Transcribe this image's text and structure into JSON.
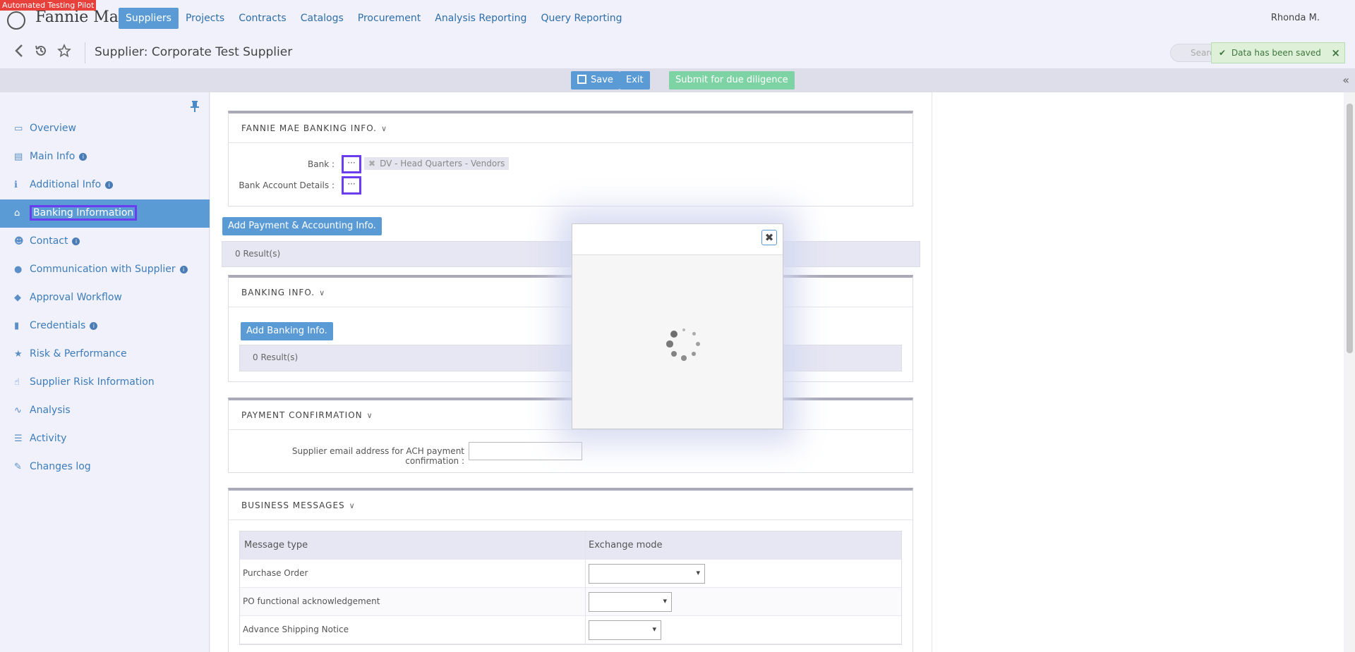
{
  "test_badge": "Automated Testing Pilot",
  "brand": {
    "name": "Fannie Mae",
    "tm": "™"
  },
  "nav": {
    "items": [
      {
        "label": "Suppliers",
        "active": true
      },
      {
        "label": "Projects"
      },
      {
        "label": "Contracts"
      },
      {
        "label": "Catalogs"
      },
      {
        "label": "Procurement"
      },
      {
        "label": "Analysis Reporting"
      },
      {
        "label": "Query Reporting"
      }
    ],
    "user": "Rhonda M."
  },
  "subheader": {
    "title": "Supplier: Corporate Test Supplier",
    "search_placeholder": "Search",
    "icons": [
      "back-icon",
      "history-icon",
      "star-icon"
    ]
  },
  "toast": {
    "message": "Data has been saved",
    "close": "×"
  },
  "actions": {
    "save": "Save",
    "exit": "Exit",
    "submit": "Submit for due diligence",
    "collapse": "«"
  },
  "sidebar": {
    "items": [
      {
        "label": "Overview",
        "icon": "monitor-icon"
      },
      {
        "label": "Main Info",
        "icon": "id-card-icon",
        "info": true
      },
      {
        "label": "Additional Info",
        "icon": "info-icon",
        "info": true
      },
      {
        "label": "Banking Information",
        "icon": "bank-icon",
        "active": true
      },
      {
        "label": "Contact",
        "icon": "users-icon",
        "info": true
      },
      {
        "label": "Communication with Supplier",
        "icon": "comments-icon",
        "info": true
      },
      {
        "label": "Approval Workflow",
        "icon": "binoculars-icon"
      },
      {
        "label": "Credentials",
        "icon": "book-icon",
        "info": true
      },
      {
        "label": "Risk & Performance",
        "icon": "star-icon"
      },
      {
        "label": "Supplier Risk Information",
        "icon": "thumbs-up-icon"
      },
      {
        "label": "Analysis",
        "icon": "line-chart-icon"
      },
      {
        "label": "Activity",
        "icon": "list-icon"
      },
      {
        "label": "Changes log",
        "icon": "edit-icon"
      }
    ]
  },
  "fm_banking": {
    "title": "FANNIE MAE BANKING INFO.",
    "bank_label": "Bank :",
    "bank_value": "DV - Head Quarters - Vendors",
    "account_label": "Bank Account Details :",
    "dots": "···"
  },
  "payment": {
    "add_button": "Add Payment & Accounting Info.",
    "results": "0 Result(s)"
  },
  "banking": {
    "title": "BANKING INFO.",
    "add_button": "Add Banking Info.",
    "results": "0 Result(s)"
  },
  "payment_confirmation": {
    "title": "PAYMENT CONFIRMATION",
    "email_label": "Supplier email address for ACH payment confirmation :"
  },
  "business_messages": {
    "title": "BUSINESS MESSAGES",
    "columns": [
      "Message type",
      "Exchange mode"
    ],
    "rows": [
      "Purchase Order",
      "PO functional acknowledgement",
      "Advance Shipping Notice"
    ]
  },
  "modal": {
    "close": "✖"
  }
}
